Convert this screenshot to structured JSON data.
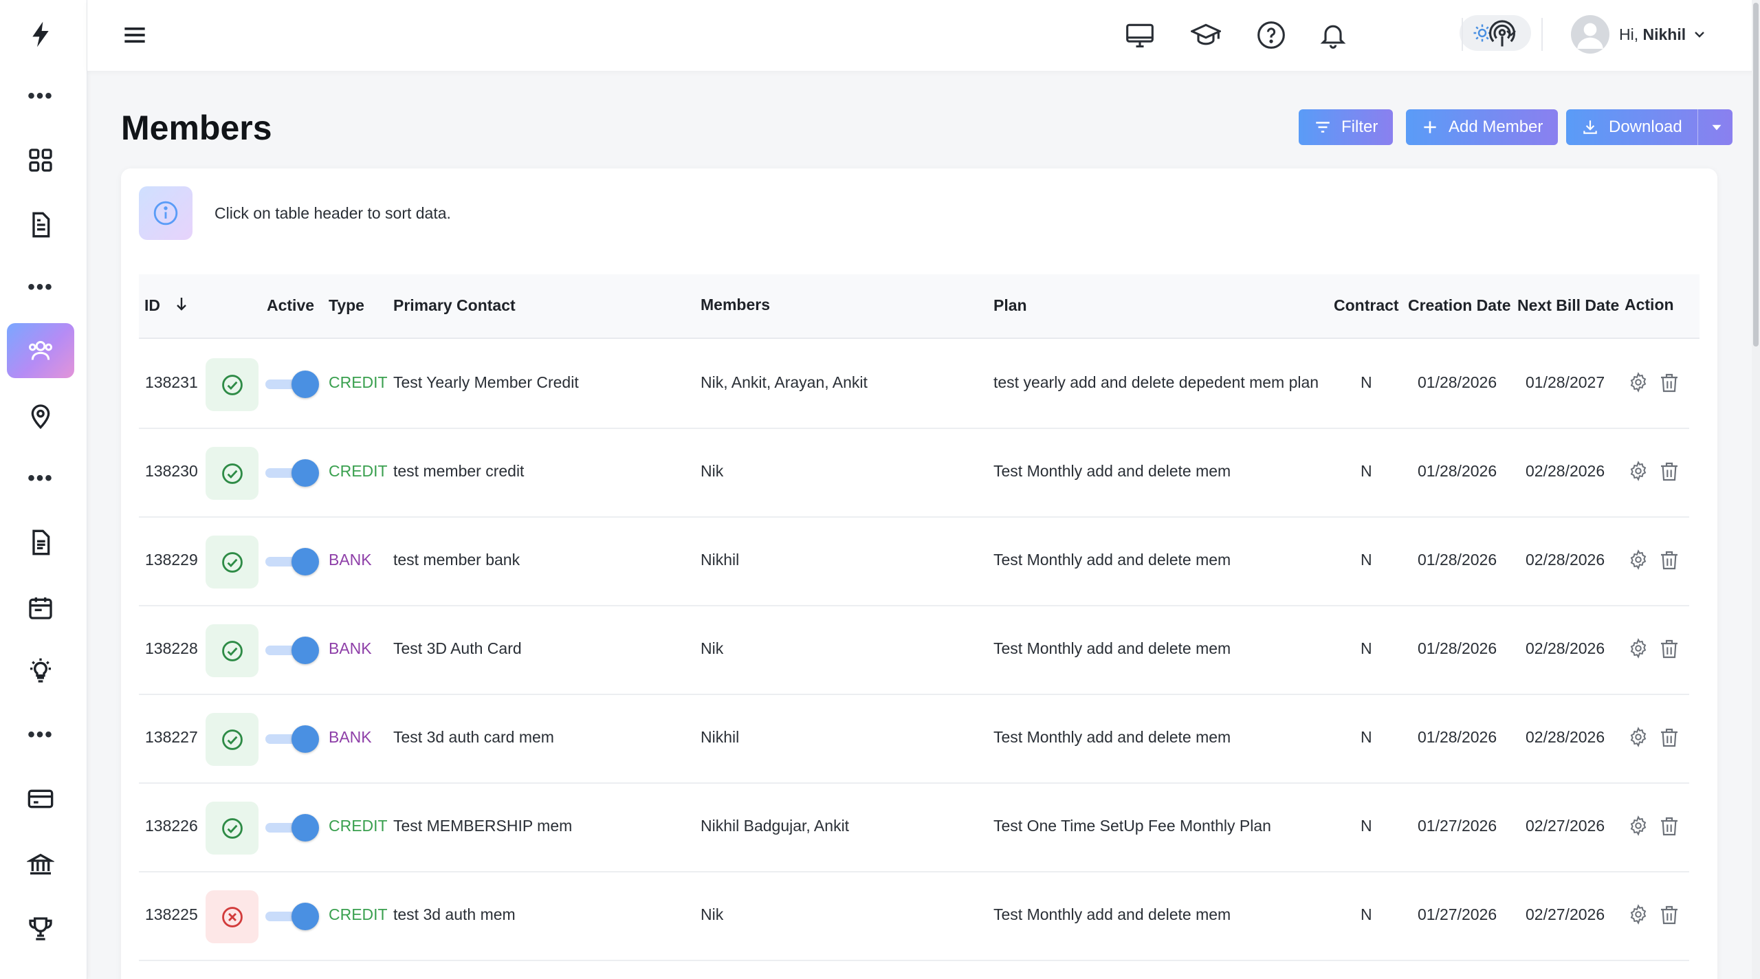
{
  "sidebar": {
    "items": [
      {
        "name": "logo-bolt-icon"
      },
      {
        "name": "more-dots"
      },
      {
        "name": "dashboard-grid-icon"
      },
      {
        "name": "document-icon"
      },
      {
        "name": "more-dots"
      },
      {
        "name": "members-icon",
        "active": true
      },
      {
        "name": "location-pin-icon"
      },
      {
        "name": "more-dots"
      },
      {
        "name": "report-icon"
      },
      {
        "name": "calendar-icon"
      },
      {
        "name": "lightbulb-icon"
      },
      {
        "name": "more-dots"
      },
      {
        "name": "credit-card-icon"
      },
      {
        "name": "bank-icon"
      },
      {
        "name": "trophy-icon"
      }
    ],
    "dots": "•••"
  },
  "topbar": {
    "greeting": "Hi,",
    "user_name": "Nikhil"
  },
  "header": {
    "title": "Members",
    "filter_label": "Filter",
    "add_member_label": "Add Member",
    "download_label": "Download"
  },
  "info": {
    "text": "Click on table header to sort data."
  },
  "table": {
    "columns": {
      "id": "ID",
      "active": "Active",
      "type": "Type",
      "primary_contact": "Primary Contact",
      "members": "Members",
      "plan": "Plan",
      "contract": "Contract",
      "creation_date": "Creation Date",
      "next_bill_date": "Next Bill Date",
      "action": "Action"
    },
    "rows": [
      {
        "id": "138231",
        "status": "ok",
        "type": "CREDIT",
        "primary_contact": "Test Yearly Member Credit",
        "members": "Nik, Ankit, Arayan, Ankit",
        "plan": "test yearly add and delete depedent mem plan",
        "contract": "N",
        "creation_date": "01/28/2026",
        "next_bill_date": "01/28/2027"
      },
      {
        "id": "138230",
        "status": "ok",
        "type": "CREDIT",
        "primary_contact": "test member credit",
        "members": "Nik",
        "plan": "Test Monthly add and delete mem",
        "contract": "N",
        "creation_date": "01/28/2026",
        "next_bill_date": "02/28/2026"
      },
      {
        "id": "138229",
        "status": "ok",
        "type": "BANK",
        "primary_contact": "test member bank",
        "members": "Nikhil",
        "plan": "Test Monthly add and delete mem",
        "contract": "N",
        "creation_date": "01/28/2026",
        "next_bill_date": "02/28/2026"
      },
      {
        "id": "138228",
        "status": "ok",
        "type": "BANK",
        "primary_contact": "Test 3D Auth Card",
        "members": "Nik",
        "plan": "Test Monthly add and delete mem",
        "contract": "N",
        "creation_date": "01/28/2026",
        "next_bill_date": "02/28/2026"
      },
      {
        "id": "138227",
        "status": "ok",
        "type": "BANK",
        "primary_contact": "Test 3d auth card mem",
        "members": "Nikhil",
        "plan": "Test Monthly add and delete mem",
        "contract": "N",
        "creation_date": "01/28/2026",
        "next_bill_date": "02/28/2026"
      },
      {
        "id": "138226",
        "status": "ok",
        "type": "CREDIT",
        "primary_contact": "Test MEMBERSHIP mem",
        "members": "Nikhil Badgujar, Ankit",
        "plan": "Test One Time SetUp Fee Monthly Plan",
        "contract": "N",
        "creation_date": "01/27/2026",
        "next_bill_date": "02/27/2026"
      },
      {
        "id": "138225",
        "status": "bad",
        "type": "CREDIT",
        "primary_contact": "test 3d auth mem",
        "members": "Nik",
        "plan": "Test Monthly add and delete mem",
        "contract": "N",
        "creation_date": "01/27/2026",
        "next_bill_date": "02/27/2026"
      }
    ]
  },
  "colors": {
    "accent_blue": "#4a90e2",
    "credit_green": "#3aa04f",
    "bank_purple": "#8e3fa8"
  }
}
